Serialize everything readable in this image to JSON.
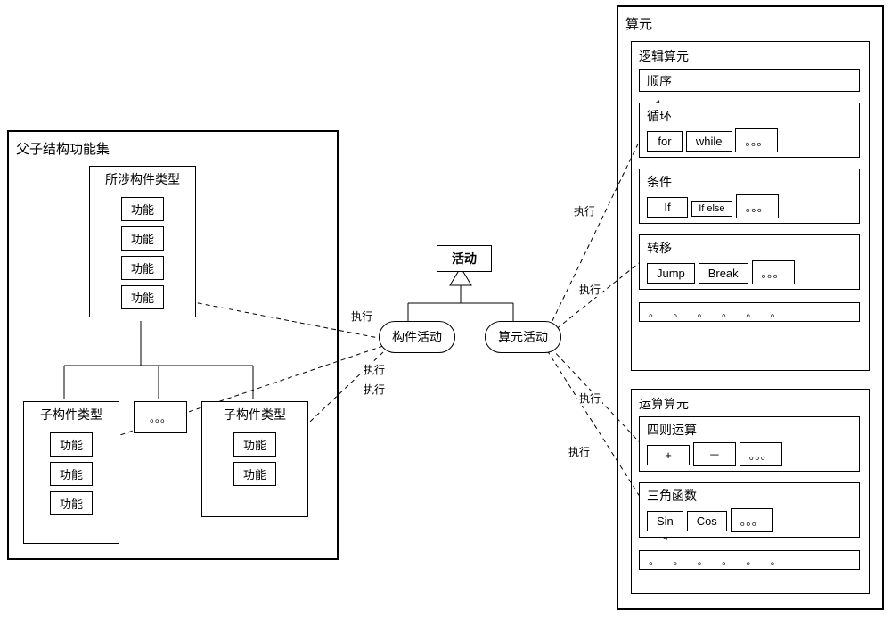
{
  "center": {
    "activity": "活动",
    "component_activity": "构件活动",
    "operator_activity": "算元活动"
  },
  "left_panel": {
    "title": "父子结构功能集",
    "involved": {
      "title": "所涉构件类型",
      "items": [
        "功能",
        "功能",
        "功能",
        "功能"
      ]
    },
    "child1": {
      "title": "子构件类型",
      "items": [
        "功能",
        "功能",
        "功能"
      ]
    },
    "child2": {
      "title": "子构件类型",
      "items": [
        "功能",
        "功能"
      ]
    },
    "sep": "。。。"
  },
  "right_panel": {
    "title": "算元",
    "logic": {
      "title": "逻辑算元",
      "seq": "顺序",
      "loop": {
        "title": "循环",
        "items": [
          "for",
          "while",
          "。。。"
        ]
      },
      "cond": {
        "title": "条件",
        "items": [
          "If",
          "If else",
          "。。。"
        ]
      },
      "jump": {
        "title": "转移",
        "items": [
          "Jump",
          "Break",
          "。。。"
        ]
      }
    },
    "calc": {
      "title": "运算算元",
      "arith": {
        "title": "四则运算",
        "items": [
          "+",
          "－",
          "。。。"
        ]
      },
      "trig": {
        "title": "三角函数",
        "items": [
          "Sin",
          "Cos",
          "。。。"
        ]
      }
    },
    "dots": "。 。 。 。 。 。"
  },
  "edges": {
    "exec": "执行"
  }
}
